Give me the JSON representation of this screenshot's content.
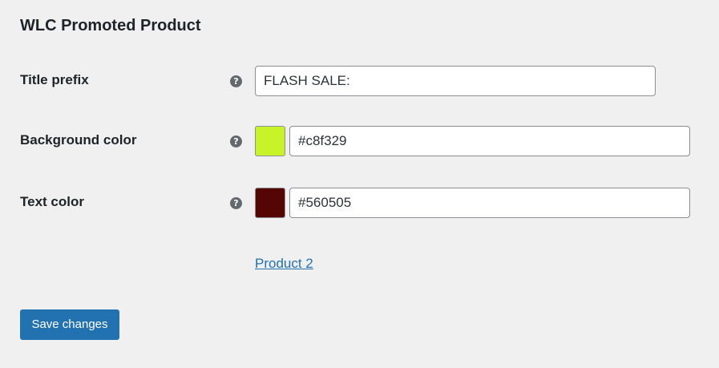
{
  "page": {
    "title": "WLC Promoted Product"
  },
  "fields": {
    "title_prefix": {
      "label": "Title prefix",
      "help_icon": "question-circle-icon",
      "value": "FLASH SALE:"
    },
    "background_color": {
      "label": "Background color",
      "help_icon": "question-circle-icon",
      "value": "#c8f329",
      "swatch_color": "#c8f329"
    },
    "text_color": {
      "label": "Text color",
      "help_icon": "question-circle-icon",
      "value": "#560505",
      "swatch_color": "#560505"
    }
  },
  "product_link": {
    "label": "Product 2"
  },
  "actions": {
    "save_label": "Save changes"
  },
  "colors": {
    "primary": "#2271b1",
    "background": "#f0f0f1"
  }
}
